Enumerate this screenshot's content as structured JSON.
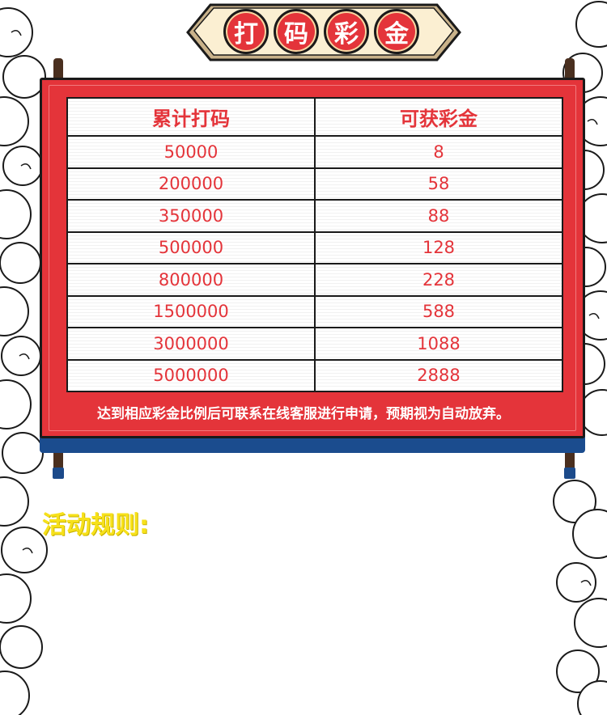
{
  "title": {
    "chars": [
      "打",
      "码",
      "彩",
      "金"
    ]
  },
  "table": {
    "headers": [
      "累计打码",
      "可获彩金"
    ],
    "rows": [
      [
        "50000",
        "8"
      ],
      [
        "200000",
        "58"
      ],
      [
        "350000",
        "88"
      ],
      [
        "500000",
        "128"
      ],
      [
        "800000",
        "228"
      ],
      [
        "1500000",
        "588"
      ],
      [
        "3000000",
        "1088"
      ],
      [
        "5000000",
        "2888"
      ]
    ]
  },
  "note": "达到相应彩金比例后可联系在线客服进行申请，预期视为自动放弃。",
  "rules_title": "活动规则:",
  "colors": {
    "board_red": "#e4343a",
    "shadow_blue": "#1b4c8e",
    "rules_yellow": "#f7e11a"
  }
}
